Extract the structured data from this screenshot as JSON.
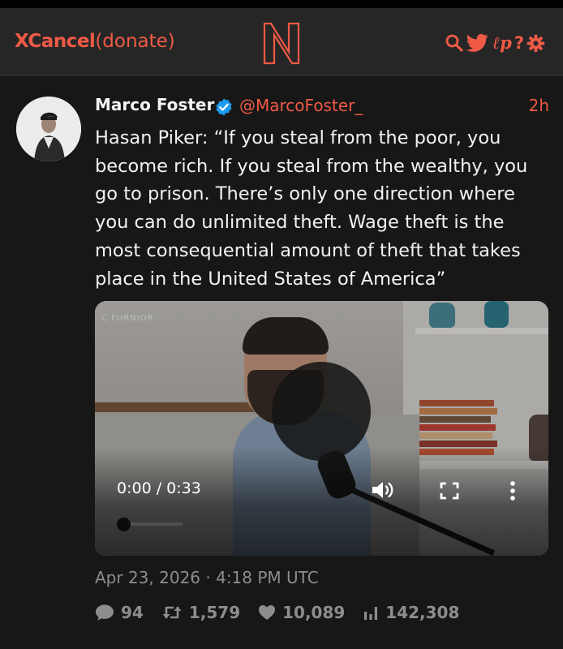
{
  "header": {
    "brand_bold": "XCancel",
    "brand_light": "(donate)",
    "logo_letter": "N",
    "icons": [
      "search-icon",
      "twitter-bird-icon",
      "lp-icon",
      "help-icon",
      "gear-icon"
    ],
    "lp_label": "ℓp",
    "help_label": "?"
  },
  "tweet": {
    "author_name": "Marco Foster",
    "verified": true,
    "handle": "@MarcoFoster_",
    "time_ago": "2h",
    "text": "Hasan Piker: “If you steal from the poor, you\nbecome rich. If you steal from the wealthy, you\ngo to prison. There’s only one direction where\nyou can do unlimited theft. Wage theft is the\nmost consequential amount of theft that takes\nplace in the United States of America”",
    "video": {
      "time_display": "0:00 / 0:33",
      "progress": 0.0,
      "watermark": "C FURNIOR"
    },
    "date": "Apr 23, 2026 · 4:18 PM UTC",
    "stats": {
      "replies": "94",
      "retweets": "1,579",
      "likes": "10,089",
      "views": "142,308"
    }
  },
  "colors": {
    "accent": "#ef5a45",
    "verified": "#1d9bf0",
    "muted": "#8d8d8d",
    "background": "#141414"
  }
}
